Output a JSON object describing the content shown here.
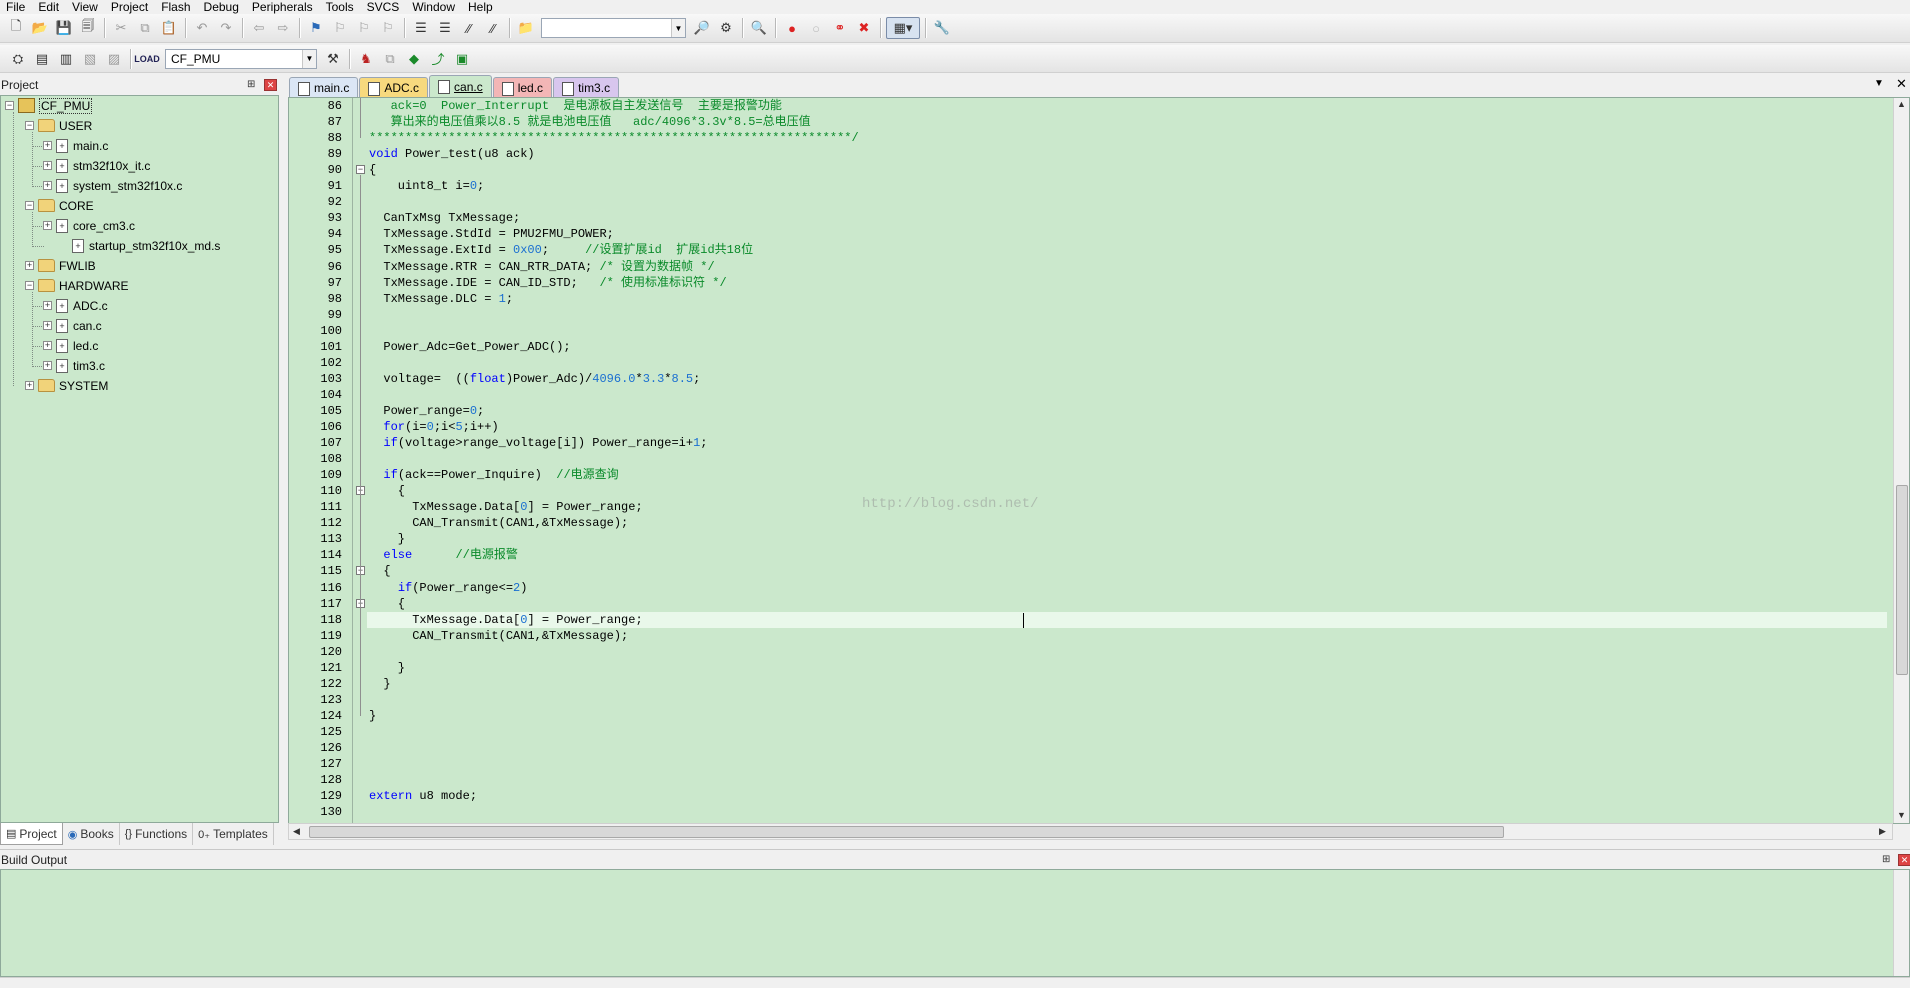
{
  "menu": [
    "File",
    "Edit",
    "View",
    "Project",
    "Flash",
    "Debug",
    "Peripherals",
    "Tools",
    "SVCS",
    "Window",
    "Help"
  ],
  "toolbar": {
    "find_value": "",
    "target": "CF_PMU"
  },
  "project_panel": {
    "title": "Project",
    "root": "CF_PMU",
    "groups": [
      {
        "name": "USER",
        "files": [
          "main.c",
          "stm32f10x_it.c",
          "system_stm32f10x.c"
        ]
      },
      {
        "name": "CORE",
        "files": [
          "core_cm3.c",
          "startup_stm32f10x_md.s"
        ]
      },
      {
        "name": "FWLIB",
        "files": []
      },
      {
        "name": "HARDWARE",
        "files": [
          "ADC.c",
          "can.c",
          "led.c",
          "tim3.c"
        ]
      },
      {
        "name": "SYSTEM",
        "files": []
      }
    ],
    "tabs": [
      "Project",
      "Books",
      "Functions",
      "Templates"
    ]
  },
  "file_tabs": [
    {
      "name": "main.c",
      "color": "#dbe6f5"
    },
    {
      "name": "ADC.c",
      "color": "#f7d97e"
    },
    {
      "name": "can.c",
      "color": "#cbe8cc"
    },
    {
      "name": "led.c",
      "color": "#f3b6b6"
    },
    {
      "name": "tim3.c",
      "color": "#d8c6ee"
    }
  ],
  "active_tab": "can.c",
  "editor": {
    "lines": [
      {
        "n": 86,
        "t": "   ack=0  Power_Interrupt  是电源板自主发送信号  主要是报警功能"
      },
      {
        "n": 87,
        "t": "   算出来的电压值乘以8.5 就是电池电压值   adc/4096*3.3v*8.5=总电压值"
      },
      {
        "n": 88,
        "t": "*******************************************************************/"
      },
      {
        "n": 89,
        "t": "void Power_test(u8 ack)"
      },
      {
        "n": 90,
        "t": "{"
      },
      {
        "n": 91,
        "t": "    uint8_t i=0;"
      },
      {
        "n": 92,
        "t": ""
      },
      {
        "n": 93,
        "t": "  CanTxMsg TxMessage;"
      },
      {
        "n": 94,
        "t": "  TxMessage.StdId = PMU2FMU_POWER;"
      },
      {
        "n": 95,
        "t": "  TxMessage.ExtId = 0x00;     //设置扩展id  扩展id共18位"
      },
      {
        "n": 96,
        "t": "  TxMessage.RTR = CAN_RTR_DATA; /* 设置为数据帧 */"
      },
      {
        "n": 97,
        "t": "  TxMessage.IDE = CAN_ID_STD;   /* 使用标准标识符 */"
      },
      {
        "n": 98,
        "t": "  TxMessage.DLC = 1;"
      },
      {
        "n": 99,
        "t": ""
      },
      {
        "n": 100,
        "t": ""
      },
      {
        "n": 101,
        "t": "  Power_Adc=Get_Power_ADC();"
      },
      {
        "n": 102,
        "t": ""
      },
      {
        "n": 103,
        "t": "  voltage=  ((float)Power_Adc)/4096.0*3.3*8.5;"
      },
      {
        "n": 104,
        "t": ""
      },
      {
        "n": 105,
        "t": "  Power_range=0;"
      },
      {
        "n": 106,
        "t": "  for(i=0;i<5;i++)"
      },
      {
        "n": 107,
        "t": "  if(voltage>range_voltage[i]) Power_range=i+1;"
      },
      {
        "n": 108,
        "t": ""
      },
      {
        "n": 109,
        "t": "  if(ack==Power_Inquire)  //电源查询"
      },
      {
        "n": 110,
        "t": "    {"
      },
      {
        "n": 111,
        "t": "      TxMessage.Data[0] = Power_range;"
      },
      {
        "n": 112,
        "t": "      CAN_Transmit(CAN1,&TxMessage);"
      },
      {
        "n": 113,
        "t": "    }"
      },
      {
        "n": 114,
        "t": "  else      //电源报警"
      },
      {
        "n": 115,
        "t": "  {"
      },
      {
        "n": 116,
        "t": "    if(Power_range<=2)"
      },
      {
        "n": 117,
        "t": "    {"
      },
      {
        "n": 118,
        "t": "      TxMessage.Data[0] = Power_range;"
      },
      {
        "n": 119,
        "t": "      CAN_Transmit(CAN1,&TxMessage);"
      },
      {
        "n": 120,
        "t": ""
      },
      {
        "n": 121,
        "t": "    }"
      },
      {
        "n": 122,
        "t": "  }"
      },
      {
        "n": 123,
        "t": ""
      },
      {
        "n": 124,
        "t": "}"
      },
      {
        "n": 125,
        "t": ""
      },
      {
        "n": 126,
        "t": ""
      },
      {
        "n": 127,
        "t": ""
      },
      {
        "n": 128,
        "t": ""
      },
      {
        "n": 129,
        "t": "extern u8 mode;"
      },
      {
        "n": 130,
        "t": ""
      }
    ],
    "current_line": 118,
    "watermark": "http://blog.csdn.net/"
  },
  "build_output": {
    "title": "Build Output",
    "text": ""
  }
}
